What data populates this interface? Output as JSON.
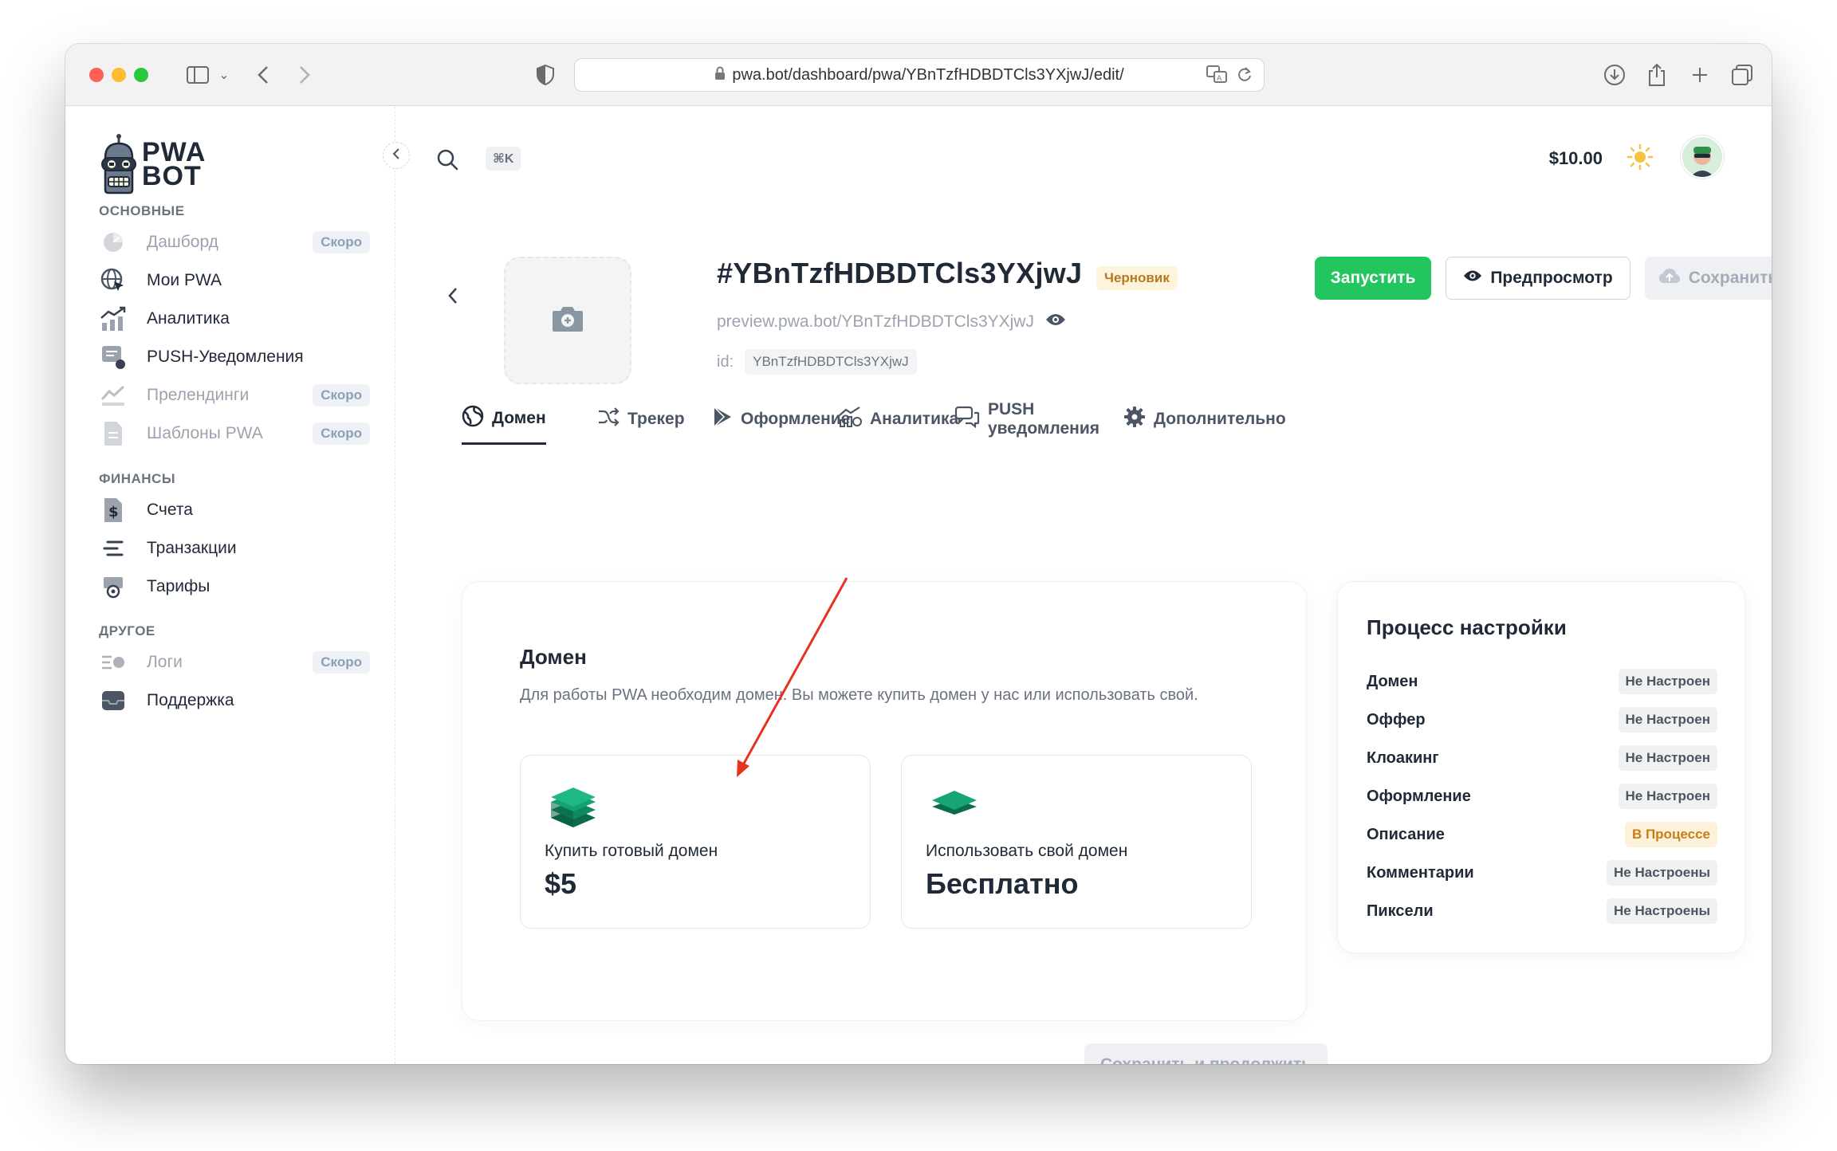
{
  "browser": {
    "url_display": "pwa.bot/dashboard/pwa/YBnTzfHDBDTCls3YXjwJ/edit/"
  },
  "sidebar": {
    "logo_text_line1": "PWA",
    "logo_text_line2": "BOT",
    "sections": {
      "main_title": "ОСНОВНЫЕ",
      "finance_title": "ФИНАНСЫ",
      "other_title": "ДРУГОЕ"
    },
    "items": [
      {
        "label": "Дашборд",
        "badge": "Скоро"
      },
      {
        "label": "Мои PWA"
      },
      {
        "label": "Аналитика"
      },
      {
        "label": "PUSH-Уведомления"
      },
      {
        "label": "Прелендинги",
        "badge": "Скоро"
      },
      {
        "label": "Шаблоны PWA",
        "badge": "Скоро"
      },
      {
        "label": "Счета"
      },
      {
        "label": "Транзакции"
      },
      {
        "label": "Тарифы"
      },
      {
        "label": "Логи",
        "badge": "Скоро"
      },
      {
        "label": "Поддержка"
      }
    ]
  },
  "header": {
    "shortcut": "⌘K",
    "balance": "$10.00"
  },
  "pwa": {
    "title": "#YBnTzfHDBDTCls3YXjwJ",
    "status": "Черновик",
    "preview_url": "preview.pwa.bot/YBnTzfHDBDTCls3YXjwJ",
    "id_label": "id:",
    "id_value": "YBnTzfHDBDTCls3YXjwJ"
  },
  "actions": {
    "launch": "Запустить",
    "preview": "Предпросмотр",
    "save": "Сохранить"
  },
  "tabs": [
    {
      "label": "Домен",
      "active": true
    },
    {
      "label": "Трекер"
    },
    {
      "label": "Оформление"
    },
    {
      "label": "Аналитика"
    },
    {
      "label": "PUSH уведомления"
    },
    {
      "label": "Дополнительно"
    }
  ],
  "domain_card": {
    "title": "Домен",
    "description": "Для работы PWA необходим домен. Вы можете купить домен у нас или использовать свой.",
    "options": [
      {
        "label": "Купить готовый домен",
        "price": "$5"
      },
      {
        "label": "Использовать свой домен",
        "price": "Бесплатно"
      }
    ]
  },
  "setup": {
    "title": "Процесс настройки",
    "steps": [
      {
        "label": "Домен",
        "status": "Не Настроен"
      },
      {
        "label": "Оффер",
        "status": "Не Настроен"
      },
      {
        "label": "Клоакинг",
        "status": "Не Настроен"
      },
      {
        "label": "Оформление",
        "status": "Не Настроен"
      },
      {
        "label": "Описание",
        "status": "В Процессе"
      },
      {
        "label": "Комментарии",
        "status": "Не Настроены"
      },
      {
        "label": "Пиксели",
        "status": "Не Настроены"
      }
    ]
  },
  "footer": {
    "continue": "Сохранить и продолжить"
  },
  "colors": {
    "accent_green": "#22c55e",
    "domain_icon_green": "#0f9d6e",
    "annotation_arrow": "#e5331f"
  }
}
